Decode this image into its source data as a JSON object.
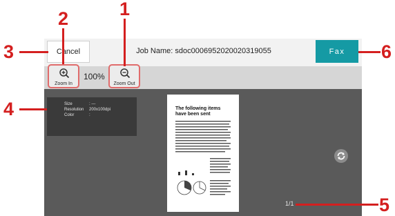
{
  "header": {
    "cancel_label": "Cancel",
    "job_name": "Job Name: sdoc0006952020020319055",
    "fax_label": "Fax"
  },
  "toolbar": {
    "zoom_in_label": "Zoom In",
    "zoom_out_label": "Zoom Out",
    "zoom_value": "100%"
  },
  "info": {
    "size_label": "Size",
    "size_value": ": ---",
    "resolution_label": "Resolution",
    "resolution_value": "200x100dpi",
    "color_label": "Color",
    "color_value": ":"
  },
  "preview": {
    "doc_heading": "The following items have been sent",
    "page_indicator": "1/1"
  },
  "callouts": [
    "1",
    "2",
    "3",
    "4",
    "5",
    "6"
  ],
  "colors": {
    "accent": "#159aa4",
    "callout": "#d41f1f",
    "highlight": "#e06b6b"
  },
  "icons": [
    "zoom-in-icon",
    "zoom-out-icon",
    "rotate-icon"
  ]
}
